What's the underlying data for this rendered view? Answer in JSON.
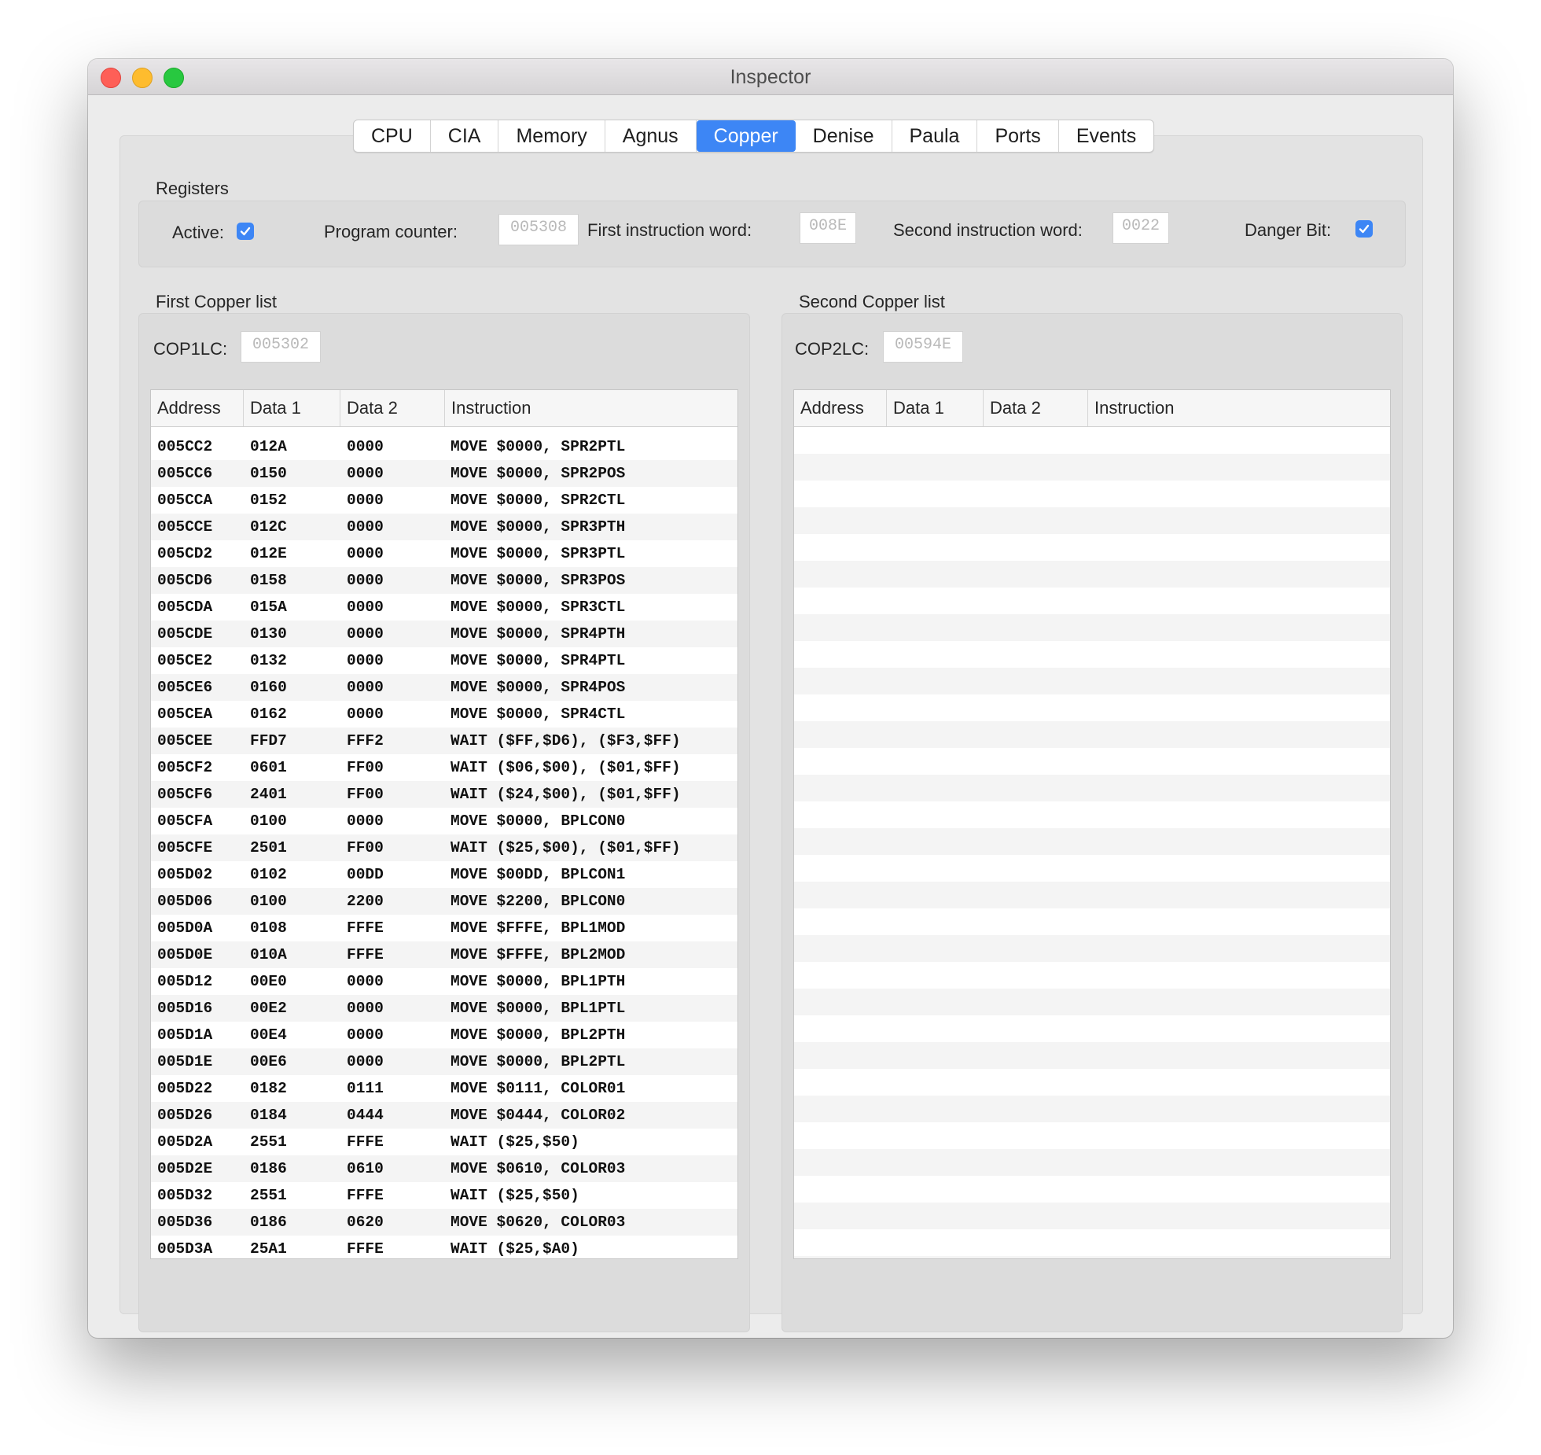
{
  "window": {
    "title": "Inspector"
  },
  "tabs": [
    "CPU",
    "CIA",
    "Memory",
    "Agnus",
    "Copper",
    "Denise",
    "Paula",
    "Ports",
    "Events"
  ],
  "active_tab": "Copper",
  "registers": {
    "section_label": "Registers",
    "active_label": "Active:",
    "active_checked": true,
    "pc_label": "Program counter:",
    "pc_value": "005308",
    "first_word_label": "First instruction word:",
    "first_word_value": "008E",
    "second_word_label": "Second instruction word:",
    "second_word_value": "0022",
    "danger_label": "Danger Bit:",
    "danger_checked": true
  },
  "list1": {
    "label": "First Copper list",
    "loc_label": "COP1LC:",
    "loc_value": "005302",
    "columns": [
      "Address",
      "Data 1",
      "Data 2",
      "Instruction"
    ],
    "rows": [
      [
        "005CC2",
        "012A",
        "0000",
        "MOVE $0000, SPR2PTL"
      ],
      [
        "005CC6",
        "0150",
        "0000",
        "MOVE $0000, SPR2POS"
      ],
      [
        "005CCA",
        "0152",
        "0000",
        "MOVE $0000, SPR2CTL"
      ],
      [
        "005CCE",
        "012C",
        "0000",
        "MOVE $0000, SPR3PTH"
      ],
      [
        "005CD2",
        "012E",
        "0000",
        "MOVE $0000, SPR3PTL"
      ],
      [
        "005CD6",
        "0158",
        "0000",
        "MOVE $0000, SPR3POS"
      ],
      [
        "005CDA",
        "015A",
        "0000",
        "MOVE $0000, SPR3CTL"
      ],
      [
        "005CDE",
        "0130",
        "0000",
        "MOVE $0000, SPR4PTH"
      ],
      [
        "005CE2",
        "0132",
        "0000",
        "MOVE $0000, SPR4PTL"
      ],
      [
        "005CE6",
        "0160",
        "0000",
        "MOVE $0000, SPR4POS"
      ],
      [
        "005CEA",
        "0162",
        "0000",
        "MOVE $0000, SPR4CTL"
      ],
      [
        "005CEE",
        "FFD7",
        "FFF2",
        "WAIT ($FF,$D6), ($F3,$FF)"
      ],
      [
        "005CF2",
        "0601",
        "FF00",
        "WAIT ($06,$00), ($01,$FF)"
      ],
      [
        "005CF6",
        "2401",
        "FF00",
        "WAIT ($24,$00), ($01,$FF)"
      ],
      [
        "005CFA",
        "0100",
        "0000",
        "MOVE $0000, BPLCON0"
      ],
      [
        "005CFE",
        "2501",
        "FF00",
        "WAIT ($25,$00), ($01,$FF)"
      ],
      [
        "005D02",
        "0102",
        "00DD",
        "MOVE $00DD, BPLCON1"
      ],
      [
        "005D06",
        "0100",
        "2200",
        "MOVE $2200, BPLCON0"
      ],
      [
        "005D0A",
        "0108",
        "FFFE",
        "MOVE $FFFE, BPL1MOD"
      ],
      [
        "005D0E",
        "010A",
        "FFFE",
        "MOVE $FFFE, BPL2MOD"
      ],
      [
        "005D12",
        "00E0",
        "0000",
        "MOVE $0000, BPL1PTH"
      ],
      [
        "005D16",
        "00E2",
        "0000",
        "MOVE $0000, BPL1PTL"
      ],
      [
        "005D1A",
        "00E4",
        "0000",
        "MOVE $0000, BPL2PTH"
      ],
      [
        "005D1E",
        "00E6",
        "0000",
        "MOVE $0000, BPL2PTL"
      ],
      [
        "005D22",
        "0182",
        "0111",
        "MOVE $0111, COLOR01"
      ],
      [
        "005D26",
        "0184",
        "0444",
        "MOVE $0444, COLOR02"
      ],
      [
        "005D2A",
        "2551",
        "FFFE",
        "WAIT ($25,$50)"
      ],
      [
        "005D2E",
        "0186",
        "0610",
        "MOVE $0610, COLOR03"
      ],
      [
        "005D32",
        "2551",
        "FFFE",
        "WAIT ($25,$50)"
      ],
      [
        "005D36",
        "0186",
        "0620",
        "MOVE $0620, COLOR03"
      ],
      [
        "005D3A",
        "25A1",
        "FFFE",
        "WAIT ($25,$A0)"
      ]
    ]
  },
  "list2": {
    "label": "Second Copper list",
    "loc_label": "COP2LC:",
    "loc_value": "00594E",
    "columns": [
      "Address",
      "Data 1",
      "Data 2",
      "Instruction"
    ],
    "rows": []
  },
  "colors": {
    "accent": "#3d86f5"
  }
}
